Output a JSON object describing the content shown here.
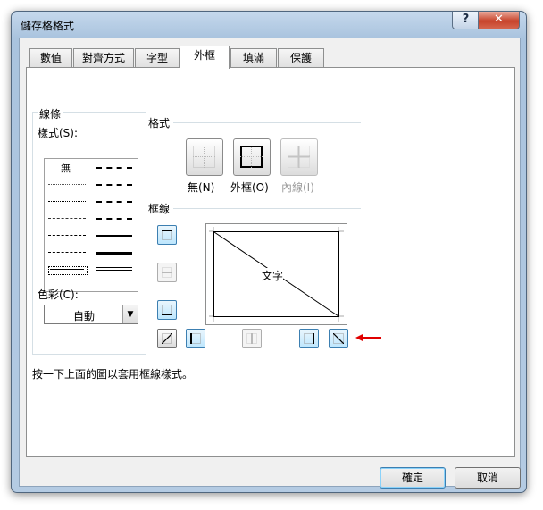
{
  "dialog": {
    "title": "儲存格格式",
    "help_label": "?",
    "close_label": "✕"
  },
  "tabs": [
    {
      "label": "數值"
    },
    {
      "label": "對齊方式"
    },
    {
      "label": "字型"
    },
    {
      "label": "外框",
      "active": true
    },
    {
      "label": "填滿"
    },
    {
      "label": "保護"
    }
  ],
  "line_group": {
    "title": "線條",
    "style_label": "樣式(S):",
    "none_label": "無",
    "color_label": "色彩(C):",
    "color_value": "自動"
  },
  "presets": {
    "title": "格式",
    "items": [
      {
        "label": "無(N)",
        "icon": "border-none-icon"
      },
      {
        "label": "外框(O)",
        "icon": "border-outline-icon"
      },
      {
        "label": "內線(I)",
        "icon": "border-inside-icon",
        "disabled": true
      }
    ]
  },
  "border": {
    "title": "框線",
    "preview_text": "文字"
  },
  "hint": "按一下上面的圖以套用框線樣式。",
  "buttons": {
    "ok": "確定",
    "cancel": "取消"
  },
  "colors": {
    "active_border_button": "#bde6fd",
    "annotation_arrow": "#e00000"
  }
}
